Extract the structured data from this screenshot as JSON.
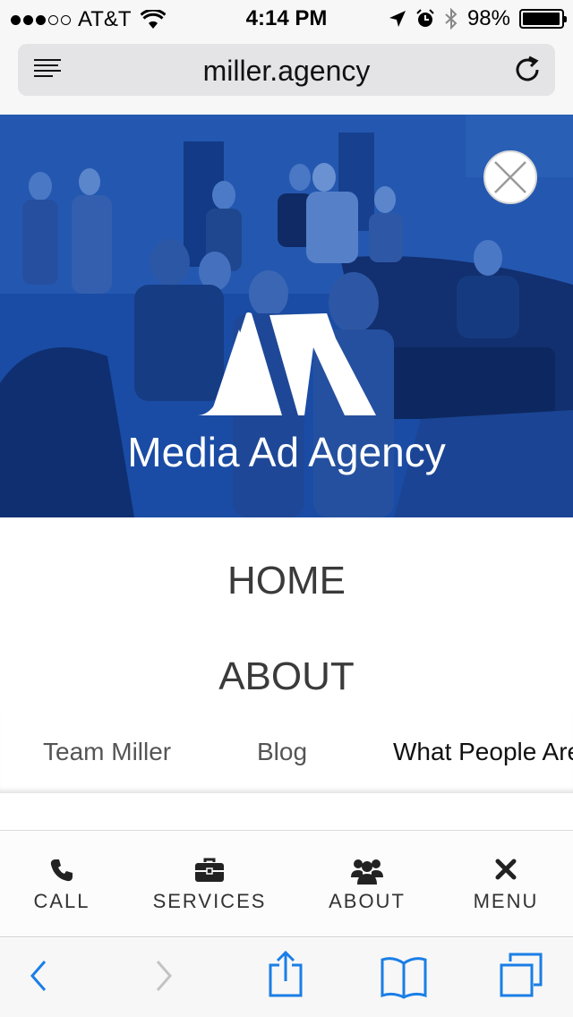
{
  "status_bar": {
    "carrier": "AT&T",
    "time": "4:14 PM",
    "battery": "98%",
    "battery_level": 0.98
  },
  "browser": {
    "url": "miller.agency"
  },
  "hero": {
    "brand_name": "Media Ad Agency",
    "accent": "#1a4ca5"
  },
  "menu": {
    "home": "HOME",
    "about": "ABOUT",
    "submenu": [
      "Team Miller",
      "Blog",
      "What People Are"
    ]
  },
  "action_bar": {
    "items": [
      {
        "label": "CALL",
        "icon": "phone-icon"
      },
      {
        "label": "SERVICES",
        "icon": "briefcase-icon"
      },
      {
        "label": "ABOUT",
        "icon": "users-icon"
      },
      {
        "label": "MENU",
        "icon": "close-x-icon"
      }
    ]
  },
  "safari_toolbar": {
    "icons": [
      "back-icon",
      "forward-icon",
      "share-icon",
      "bookmarks-icon",
      "tabs-icon"
    ],
    "accent": "#1a7ee6"
  }
}
